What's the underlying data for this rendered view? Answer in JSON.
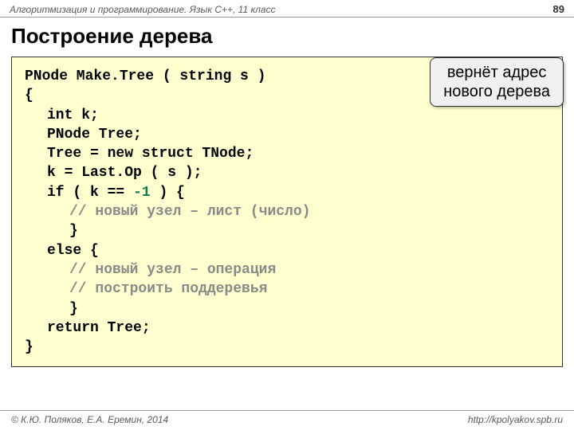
{
  "header": {
    "course": "Алгоритмизация и программирование. Язык C++, 11 класс",
    "page": "89"
  },
  "title": "Построение дерева",
  "callout": {
    "line1": "вернёт адрес",
    "line2": "нового дерева"
  },
  "code": {
    "l0": "PNode Make.Tree ( string s )",
    "l1": "{",
    "l2": "int k;",
    "l3": "PNode Tree;",
    "l4": "Tree = new struct TNode;",
    "l5": "k = Last.Op ( s );",
    "l6a": "if ( k == ",
    "l6b": "-1",
    "l6c": " ) {",
    "l7": "// новый узел – лист (число)",
    "l8": "}",
    "l9": "else {",
    "l10": "// новый узел – операция",
    "l11": "// построить поддеревья",
    "l12": "}",
    "l13": "return Tree;",
    "l14": "}"
  },
  "footer": {
    "copyright": "© К.Ю. Поляков, Е.А. Еремин, 2014",
    "url": "http://kpolyakov.spb.ru"
  }
}
